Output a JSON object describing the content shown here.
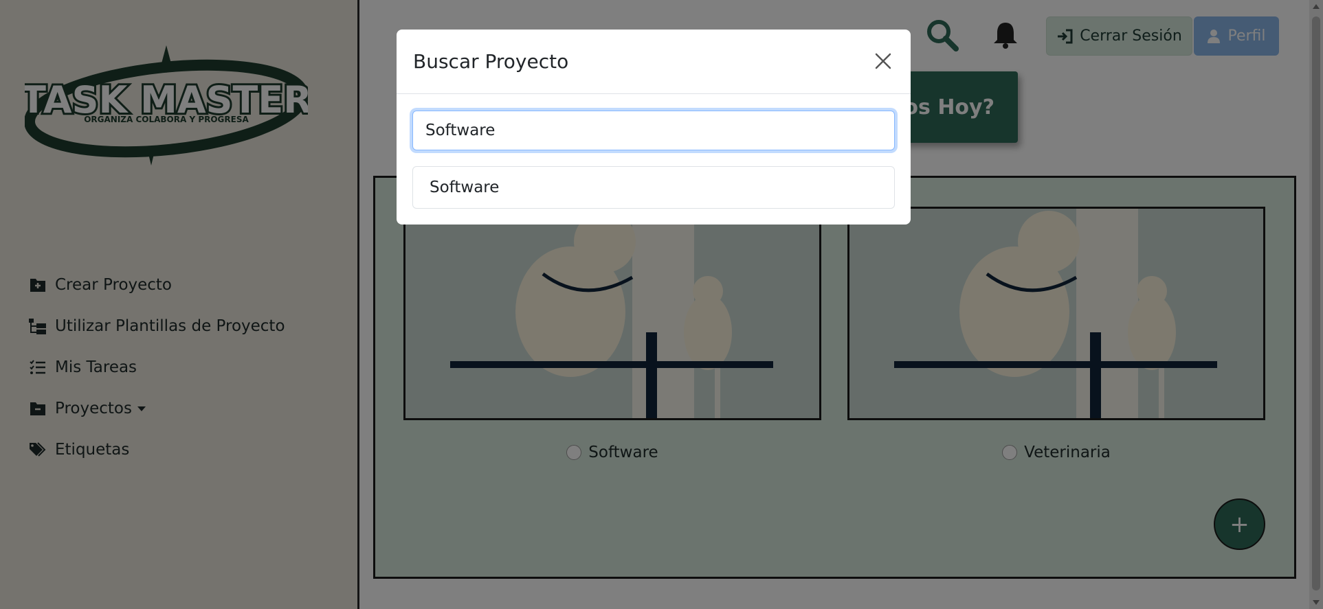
{
  "logo": {
    "title": "TASK MASTER",
    "tagline": "ORGANIZA COLABORA Y PROGRESA"
  },
  "sidebar": {
    "items": [
      {
        "label": "Crear Proyecto",
        "icon": "folder-plus-icon"
      },
      {
        "label": "Utilizar Plantillas de Proyecto",
        "icon": "folder-tree-icon"
      },
      {
        "label": "Mis Tareas",
        "icon": "list-check-icon"
      },
      {
        "label": "Proyectos",
        "icon": "folder-minus-icon",
        "has_dropdown": true
      },
      {
        "label": "Etiquetas",
        "icon": "tags-icon"
      }
    ]
  },
  "header": {
    "logout_label": "Cerrar Sesión",
    "profile_label": "Perfil",
    "greeting_partial": "nos Hoy?"
  },
  "projects": [
    {
      "label": "Software",
      "selected": false
    },
    {
      "label": "Veterinaria",
      "selected": false
    }
  ],
  "fab_label": "+",
  "modal": {
    "title": "Buscar Proyecto",
    "search_value": "Software",
    "results": [
      "Software"
    ]
  },
  "colors": {
    "brand_green": "#2f6a58",
    "panel_green": "#d7e9dd",
    "sidebar_bg": "#eae6dc",
    "profile_blue": "#8ab6e9",
    "logo_green": "#1f3d2e"
  }
}
